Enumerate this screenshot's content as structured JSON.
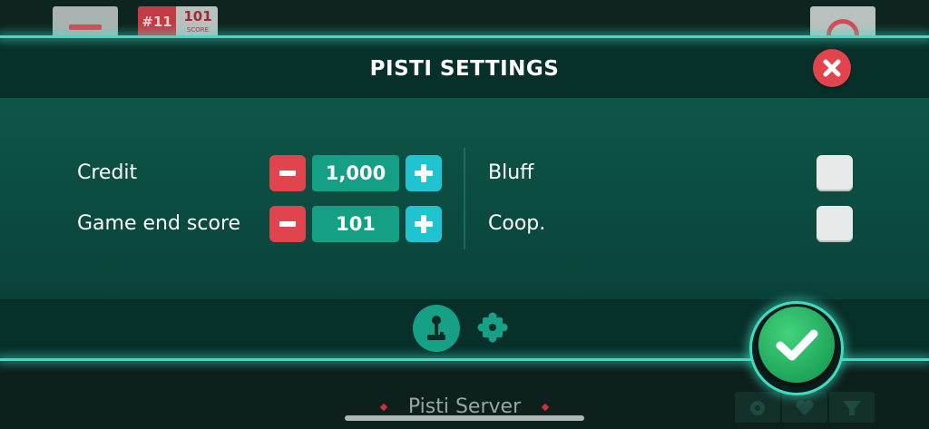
{
  "background": {
    "rank_badge": "#11",
    "score_value": "101",
    "score_label": "SCORE",
    "server_name": "Pisti Server"
  },
  "dialog": {
    "title": "PISTI SETTINGS",
    "settings": [
      {
        "label": "Credit",
        "value": "1,000"
      },
      {
        "label": "Game end score",
        "value": "101"
      }
    ],
    "options": [
      {
        "label": "Bluff",
        "checked": false
      },
      {
        "label": "Coop.",
        "checked": false
      }
    ],
    "tabs": [
      {
        "icon": "joystick-icon",
        "active": true
      },
      {
        "icon": "puzzle-icon",
        "active": false
      }
    ]
  },
  "colors": {
    "accent_glow": "#3fdcc0",
    "minus": "#e2444e",
    "plus": "#22c3d0",
    "value_bg": "#15a085",
    "confirm": "#1fa55a",
    "close": "#e2444e"
  }
}
